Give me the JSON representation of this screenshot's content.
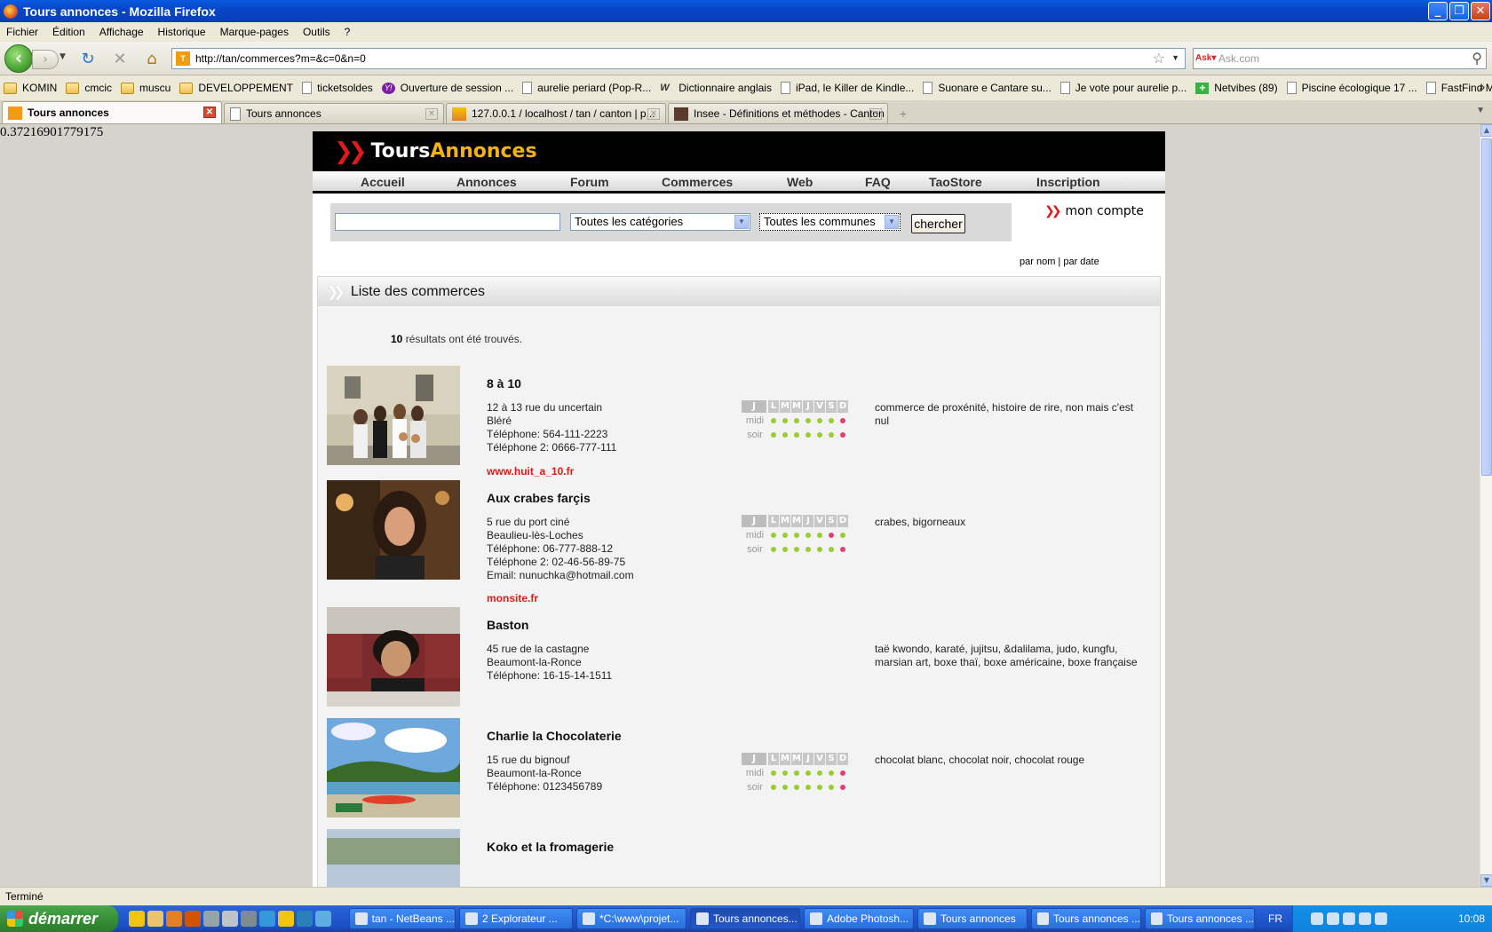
{
  "window": {
    "title": "Tours annonces - Mozilla Firefox"
  },
  "menu": [
    "Fichier",
    "Édition",
    "Affichage",
    "Historique",
    "Marque-pages",
    "Outils",
    "?"
  ],
  "nav": {
    "url": "http://tan/commerces?m=&c=0&n=0",
    "search_placeholder": "Ask.com"
  },
  "bookmarks": [
    {
      "label": "KOMIN",
      "icon": "folder-icon"
    },
    {
      "label": "cmcic",
      "icon": "folder-icon"
    },
    {
      "label": "muscu",
      "icon": "folder-icon"
    },
    {
      "label": "DEVELOPPEMENT",
      "icon": "folder-icon"
    },
    {
      "label": "ticketsoldes",
      "icon": "page-icon"
    },
    {
      "label": "Ouverture de session ...",
      "icon": "yahoo-icon"
    },
    {
      "label": "aurelie periard (Pop-R...",
      "icon": "page-icon"
    },
    {
      "label": "Dictionnaire anglais",
      "icon": "wr-icon"
    },
    {
      "label": "iPad, le Killer de Kindle...",
      "icon": "page-icon"
    },
    {
      "label": "Suonare e Cantare su...",
      "icon": "page-icon"
    },
    {
      "label": "Je vote pour aurelie p...",
      "icon": "page-icon"
    },
    {
      "label": "Netvibes (89)",
      "icon": "netvibes-icon"
    },
    {
      "label": "Piscine écologique 17 ...",
      "icon": "page-icon"
    },
    {
      "label": "FastFind Menu",
      "icon": "page-icon"
    }
  ],
  "tabs": [
    {
      "label": "Tours annonces",
      "active": true
    },
    {
      "label": "Tours annonces",
      "active": false
    },
    {
      "label": "127.0.0.1 / localhost / tan / canton | p...",
      "active": false
    },
    {
      "label": "Insee - Définitions et méthodes - Canton",
      "active": false
    }
  ],
  "page": {
    "random_number": "0.37216901779175",
    "logo_tours": "Tours",
    "logo_annonces": "Annonces",
    "nav_items": [
      "Accueil",
      "Annonces",
      "Forum",
      "Commerces",
      "Web",
      "FAQ",
      "TaoStore",
      "Inscription"
    ],
    "search": {
      "query": "",
      "category": "Toutes les catégories",
      "commune": "Toutes les communes",
      "button": "chercher"
    },
    "mon_compte": "mon compte",
    "sort_by_name": "par nom",
    "sort_sep": "|",
    "sort_by_date": "par date",
    "list_title": "Liste des commerces",
    "results_count": "10",
    "results_text": "résultats ont été trouvés.",
    "hours_labels": {
      "jours": "J",
      "midi": "midi",
      "soir": "soir",
      "days": [
        "L",
        "M",
        "M",
        "J",
        "V",
        "S",
        "D"
      ]
    },
    "colors": {
      "open": "#9acd32",
      "closed": "#e0407a",
      "brand_red": "#e01a1a",
      "brand_yellow": "#f3b21a"
    },
    "shops": [
      {
        "name": "8 à 10",
        "address": [
          "12 à 13 rue du uncertain",
          "Bléré",
          "Téléphone: 564-111-2223",
          "Téléphone 2: 0666-777-111"
        ],
        "website": "www.huit_a_10.fr",
        "description": "commerce de proxénité, histoire de rire, non mais c'est nul",
        "midi": [
          true,
          true,
          true,
          true,
          true,
          true,
          false
        ],
        "soir": [
          true,
          true,
          true,
          true,
          true,
          true,
          false
        ],
        "photo": "group-photo"
      },
      {
        "name": "Aux crabes farçis",
        "address": [
          "5 rue du port ciné",
          "Beaulieu-lès-Loches",
          "Téléphone: 06-777-888-12",
          "Téléphone 2: 02-46-56-89-75",
          "Email: nunuchka@hotmail.com"
        ],
        "website": "monsite.fr",
        "description": "crabes, bigorneaux",
        "midi": [
          true,
          true,
          true,
          true,
          true,
          false,
          true
        ],
        "soir": [
          true,
          true,
          true,
          true,
          true,
          true,
          false
        ],
        "photo": "portrait-photo"
      },
      {
        "name": "Baston",
        "address": [
          "45 rue de la castagne",
          "Beaumont-la-Ronce",
          "Téléphone: 16-15-14-1511"
        ],
        "website": "",
        "description": "taë kwondo, karaté, jujitsu, &dalilama, judo, kungfu, marsian art, boxe thaï, boxe américaine, boxe française",
        "midi": null,
        "soir": null,
        "photo": "cafe-photo"
      },
      {
        "name": "Charlie la Chocolaterie",
        "address": [
          "15 rue du bignouf",
          "Beaumont-la-Ronce",
          "Téléphone: 0123456789"
        ],
        "website": "",
        "description": "chocolat blanc, chocolat noir, chocolat rouge",
        "midi": [
          true,
          true,
          true,
          true,
          true,
          true,
          false
        ],
        "soir": [
          true,
          true,
          true,
          true,
          true,
          true,
          false
        ],
        "photo": "beach-photo"
      },
      {
        "name": "Koko et la fromagerie",
        "address": [],
        "website": "",
        "description": "",
        "midi": null,
        "soir": null,
        "photo": "landscape-photo"
      }
    ]
  },
  "status": "Terminé",
  "taskbar": {
    "start": "démarrer",
    "tasks": [
      {
        "label": "tan - NetBeans ...",
        "active": false
      },
      {
        "label": "2 Explorateur ...",
        "active": false
      },
      {
        "label": "*C:\\www\\projet...",
        "active": false
      },
      {
        "label": "Tours annonces...",
        "active": true
      },
      {
        "label": "Adobe Photosh...",
        "active": false
      },
      {
        "label": "Tours annonces",
        "active": false
      },
      {
        "label": "Tours annonces ...",
        "active": false
      },
      {
        "label": "Tours annonces ...",
        "active": false
      }
    ],
    "lang": "FR",
    "clock": "10:08"
  }
}
